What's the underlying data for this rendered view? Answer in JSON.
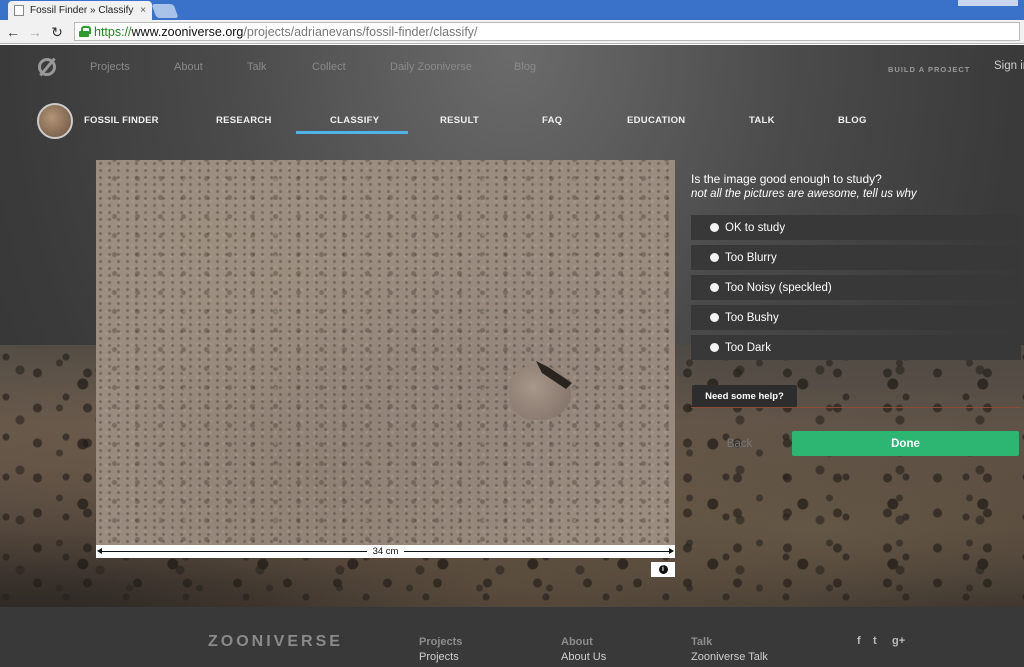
{
  "browser": {
    "tab_title": "Fossil Finder » Classify —",
    "tab_close": "×",
    "url_scheme": "https://",
    "url_host": "www.zooniverse.org",
    "url_path": "/projects/adrianevans/fossil-finder/classify/",
    "back_icon": "←",
    "forward_icon": "→",
    "reload_icon": "↻"
  },
  "topnav": {
    "items": [
      "Projects",
      "About",
      "Talk",
      "Collect",
      "Daily Zooniverse",
      "Blog"
    ],
    "build_project": "BUILD A PROJECT",
    "sign_in": "Sign in"
  },
  "project": {
    "name": "FOSSIL FINDER",
    "nav": [
      "RESEARCH",
      "CLASSIFY",
      "RESULT",
      "FAQ",
      "EDUCATION",
      "TALK",
      "BLOG"
    ],
    "active_tab": "CLASSIFY"
  },
  "subject": {
    "scale_label": "34 cm",
    "info_icon": "i"
  },
  "task": {
    "question": "Is the image good enough to study?",
    "help": "not all the pictures are awesome, tell us why",
    "answers": [
      "OK to study",
      "Too Blurry",
      "Too Noisy (speckled)",
      "Too Bushy",
      "Too Dark"
    ],
    "need_help": "Need some help?",
    "back": "Back",
    "done": "Done"
  },
  "footer": {
    "logo": "ZOONIVERSE",
    "columns": [
      {
        "head": "Projects",
        "link": "Projects"
      },
      {
        "head": "About",
        "link": "About Us"
      },
      {
        "head": "Talk",
        "link": "Zooniverse Talk"
      }
    ],
    "social": [
      "f",
      "t",
      "g+"
    ]
  },
  "colors": {
    "done_green": "#2db672",
    "active_tab_blue": "#4fb3e8",
    "answer_bg": "#383838"
  }
}
